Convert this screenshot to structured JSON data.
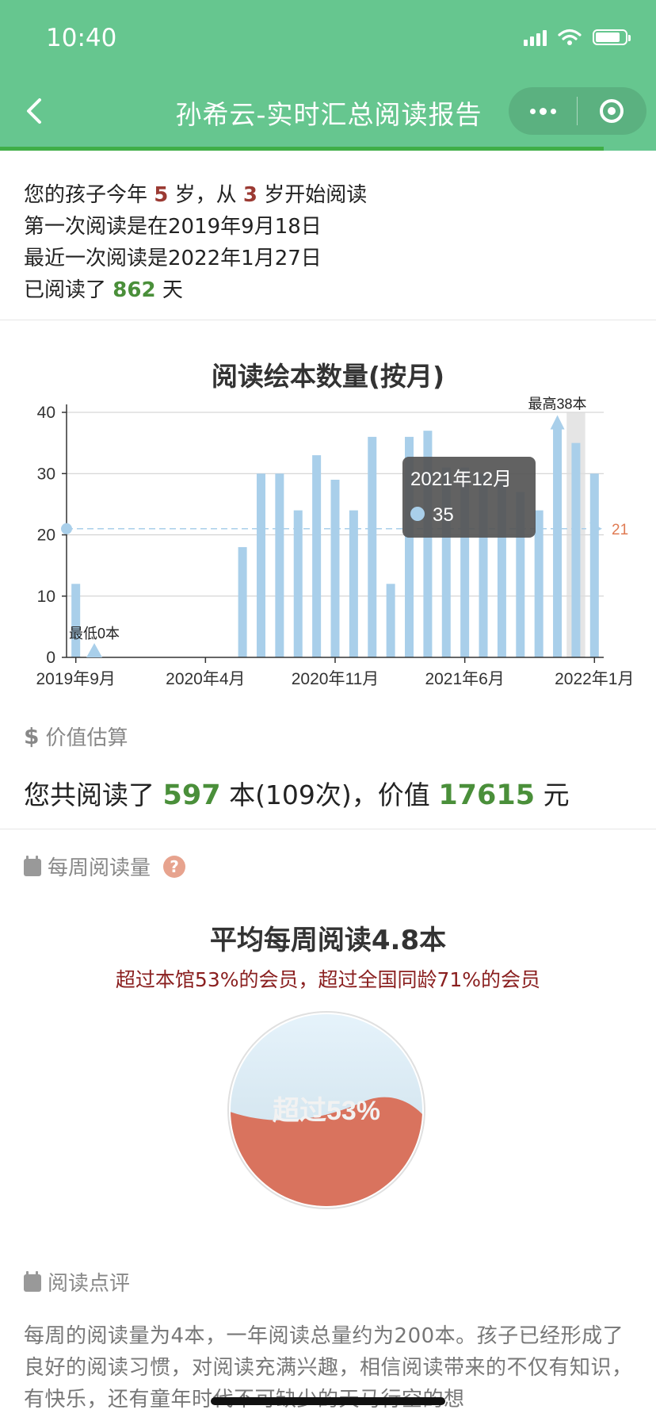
{
  "status_bar": {
    "time": "10:40"
  },
  "nav": {
    "title": "孙希云-实时汇总阅读报告"
  },
  "summary": {
    "line1_a": "您的孩子今年",
    "age": "5",
    "line1_b": "岁，从",
    "start_age": "3",
    "line1_c": "岁开始阅读",
    "first_read": "第一次阅读是在2019年9月18日",
    "last_read": "最近一次阅读是2022年1月27日",
    "days_a": "已阅读了",
    "days": "862",
    "days_b": "天"
  },
  "colors": {
    "header": "#66c68f",
    "bar": "#a9cfea",
    "highlight_red": "#9b3a33",
    "highlight_green": "#4a8f3a",
    "wave": "#d9735e",
    "avg_label": "#e07b53"
  },
  "chart_data": {
    "type": "bar",
    "title": "阅读绘本数量(按月)",
    "xlabel": "",
    "ylabel": "",
    "ylim": [
      0,
      40
    ],
    "yticks": [
      "0",
      "10",
      "20",
      "30",
      "40"
    ],
    "categories": [
      "2019年9月",
      "2019年10月",
      "2019年11月",
      "2019年12月",
      "2020年1月",
      "2020年2月",
      "2020年3月",
      "2020年4月",
      "2020年5月",
      "2020年6月",
      "2020年7月",
      "2020年8月",
      "2020年9月",
      "2020年10月",
      "2020年11月",
      "2020年12月",
      "2021年1月",
      "2021年2月",
      "2021年3月",
      "2021年4月",
      "2021年5月",
      "2021年6月",
      "2021年7月",
      "2021年8月",
      "2021年9月",
      "2021年10月",
      "2021年11月",
      "2021年12月",
      "2022年1月"
    ],
    "values": [
      12,
      0,
      0,
      0,
      0,
      0,
      0,
      0,
      0,
      18,
      30,
      30,
      24,
      33,
      29,
      24,
      36,
      12,
      36,
      37,
      31,
      31,
      30,
      29,
      27,
      24,
      38,
      35,
      30
    ],
    "xtick_labels": [
      "2019年9月",
      "2020年4月",
      "2020年11月",
      "2021年6月",
      "2022年1月"
    ],
    "xtick_indices": [
      0,
      7,
      14,
      21,
      28
    ],
    "average": 21,
    "average_label": "21",
    "max_label": "最高38本",
    "min_label": "最低0本",
    "max_index": 26,
    "min_index": 1,
    "highlight_index": 27,
    "tooltip": {
      "title": "2021年12月",
      "value": "35"
    }
  },
  "value_section": {
    "heading": "价值估算",
    "text_a": "您共阅读了",
    "books": "597",
    "text_b": "本(109次)，价值",
    "money": "17615",
    "text_c": "元"
  },
  "weekly_section": {
    "heading": "每周阅读量",
    "title": "平均每周阅读4.8本",
    "subtitle": "超过本馆53%的会员，超过全国同龄71%的会员",
    "liquid_label": "超过53%",
    "liquid_percent": 0.53
  },
  "comment_section": {
    "heading": "阅读点评",
    "text": "每周的阅读量为4本，一年阅读总量约为200本。孩子已经形成了良好的阅读习惯，对阅读充满兴趣，相信阅读带来的不仅有知识，有快乐，还有童年时代不可缺少的天马行空的想"
  }
}
